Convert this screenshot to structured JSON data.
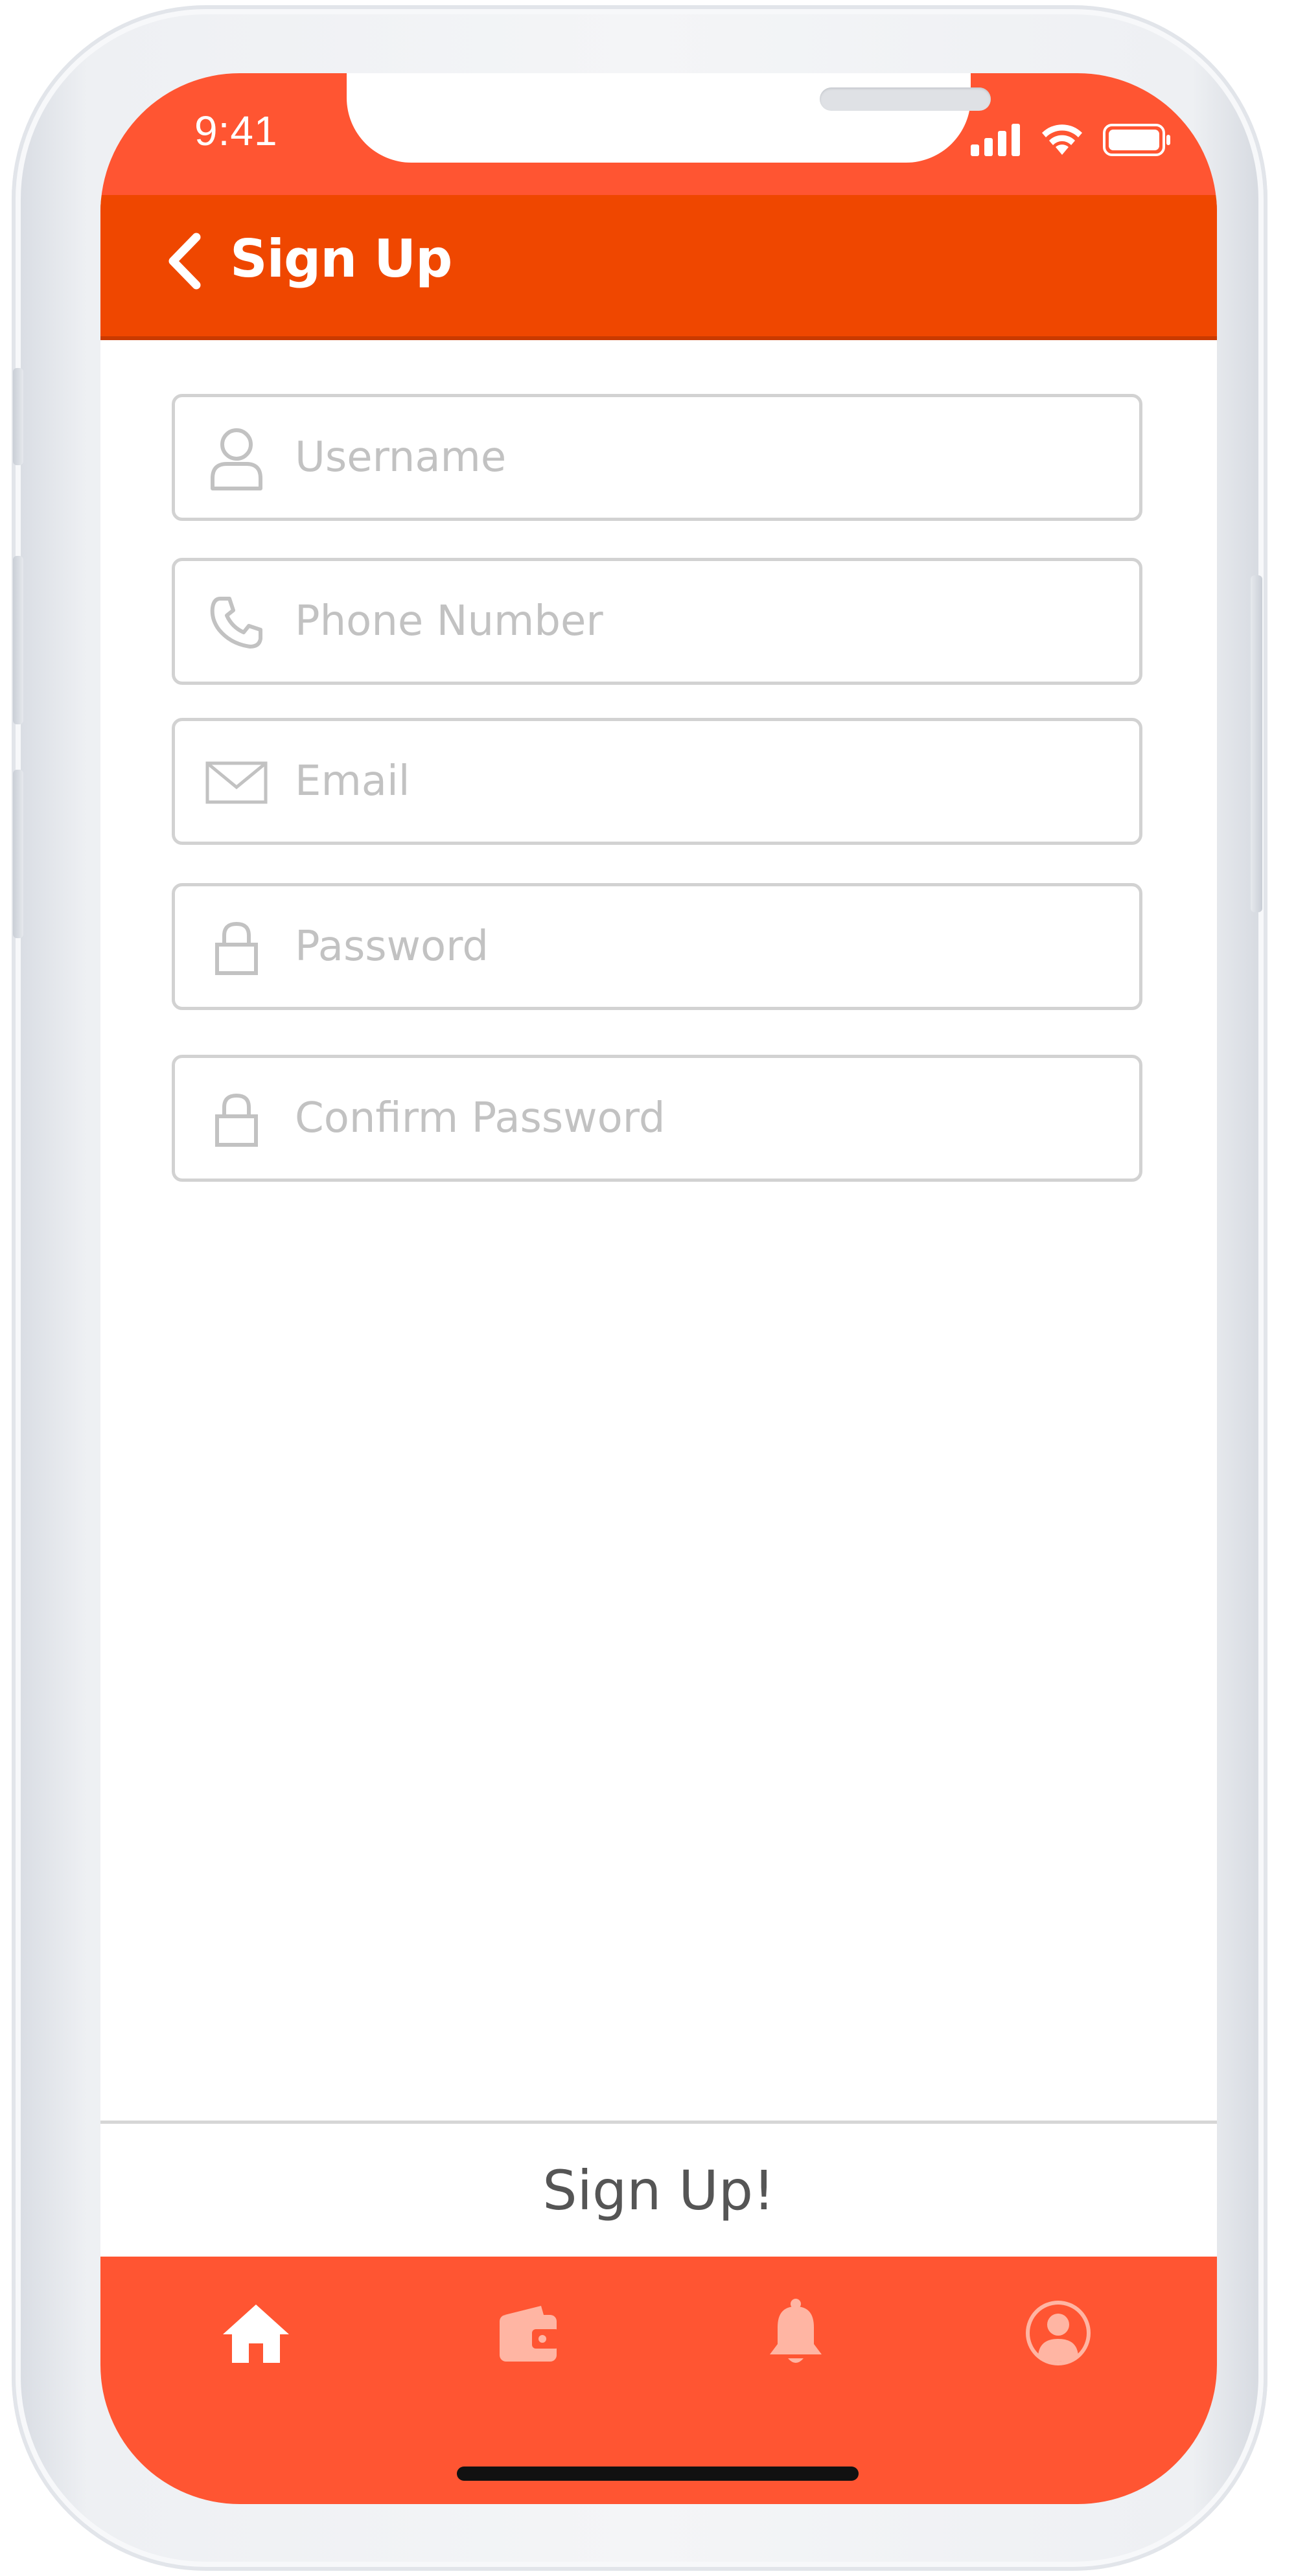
{
  "status_bar": {
    "time": "9:41",
    "icons": [
      "cellular-signal-icon",
      "wifi-icon",
      "battery-icon"
    ]
  },
  "header": {
    "title": "Sign Up",
    "back_icon": "chevron-left-icon"
  },
  "form": {
    "fields": [
      {
        "placeholder": "Username",
        "value": "",
        "icon": "user-icon"
      },
      {
        "placeholder": "Phone Number",
        "value": "",
        "icon": "phone-icon"
      },
      {
        "placeholder": "Email",
        "value": "",
        "icon": "envelope-icon"
      },
      {
        "placeholder": "Password",
        "value": "",
        "icon": "lock-icon"
      },
      {
        "placeholder": "Confirm Password",
        "value": "",
        "icon": "lock-icon"
      }
    ]
  },
  "submit": {
    "label": "Sign Up!"
  },
  "tab_bar": {
    "tabs": [
      {
        "icon": "home-icon",
        "active": true
      },
      {
        "icon": "wallet-icon",
        "active": false
      },
      {
        "icon": "bell-icon",
        "active": false
      },
      {
        "icon": "profile-icon",
        "active": false
      }
    ]
  },
  "colors": {
    "status_bar": "#ff5532",
    "header": "#ef4700",
    "tab_bar": "#ff5532",
    "field_border": "#d2d2d2",
    "placeholder": "#c2c2c2",
    "submit_text": "#555555",
    "tab_inactive_icon": "#ffb5a3"
  }
}
